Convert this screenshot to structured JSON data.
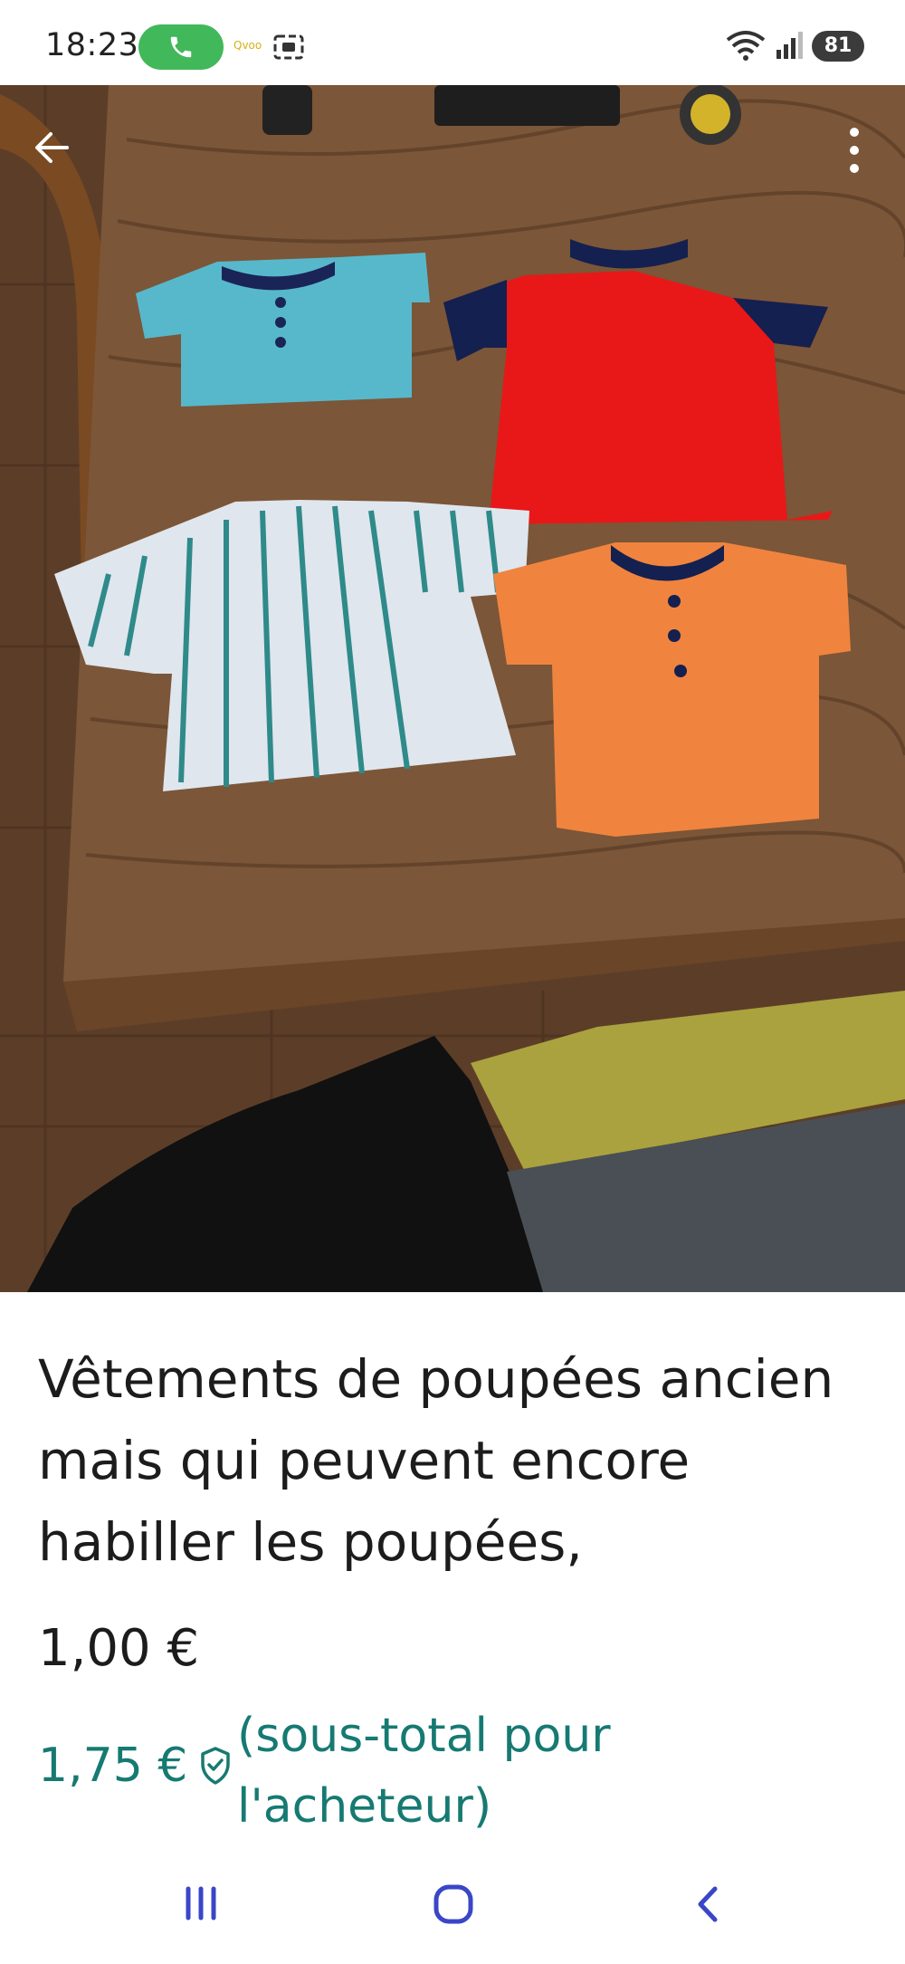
{
  "status_bar": {
    "time": "18:23",
    "notification_text": "Qvoo",
    "battery": "81"
  },
  "listing": {
    "title": "Vêtements de poupées ancien mais qui peuvent encore habiller les poupées,",
    "price": "1,00 €",
    "buyer_total": "1,75 €",
    "buyer_total_note": "(sous-total pour l'acheteur)"
  },
  "colors": {
    "accent": "#167a72",
    "call_green": "#41b85a",
    "nav_icon": "#3a46c8"
  },
  "icons": [
    "back-arrow-icon",
    "more-vert-icon",
    "phone-icon",
    "screen-record-icon",
    "wifi-icon",
    "signal-icon",
    "shield-check-icon",
    "recent-apps-icon",
    "home-icon",
    "back-nav-icon"
  ]
}
